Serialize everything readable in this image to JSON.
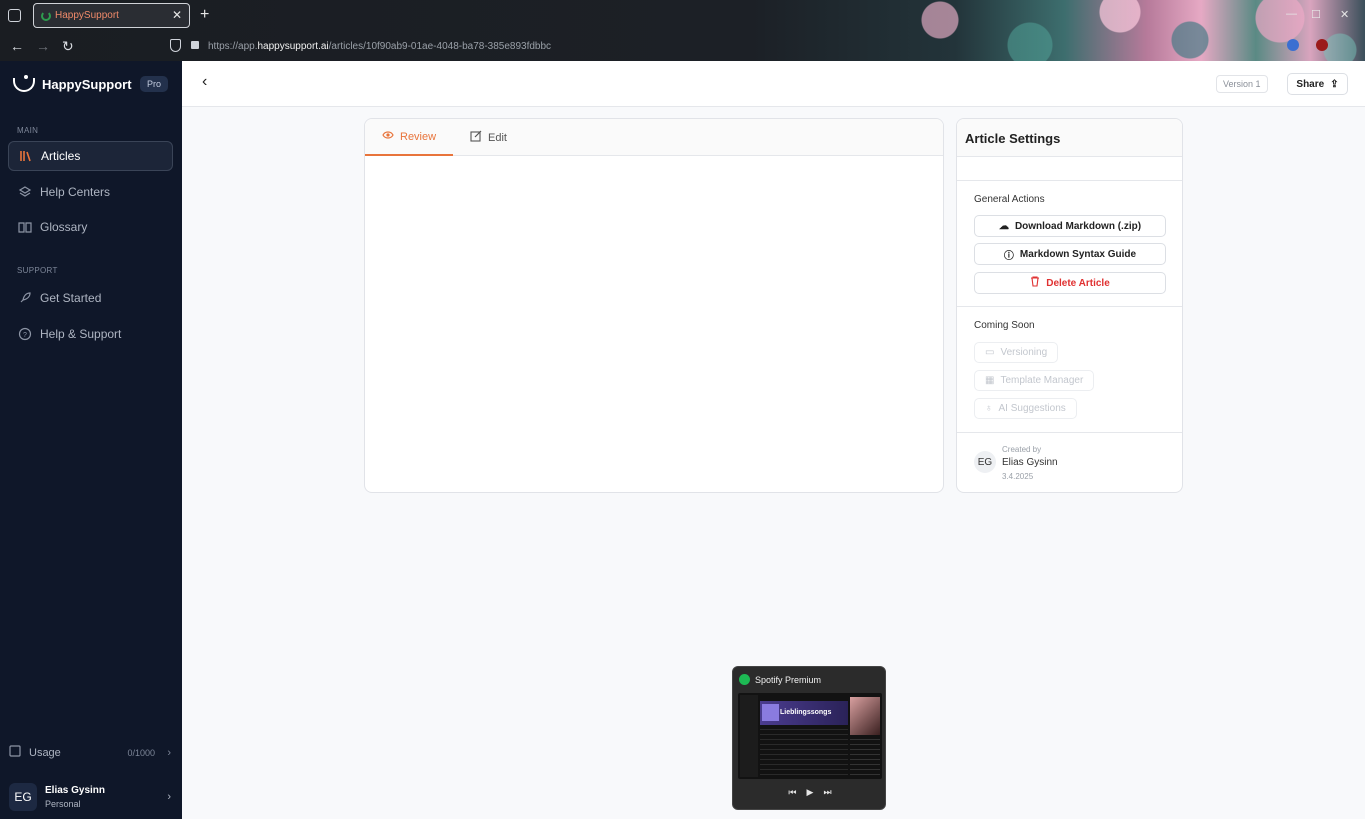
{
  "browser": {
    "tab_title": "HappySupport",
    "url_prefix": "https://app.",
    "url_domain": "happysupport.ai",
    "url_path": "/articles/10f90ab9-01ae-4048-ba78-385e893fdbbc"
  },
  "sidebar": {
    "brand": "HappySupport",
    "plan_badge": "Pro",
    "main_label": "MAIN",
    "main_items": [
      {
        "label": "Articles",
        "icon": "library-icon"
      },
      {
        "label": "Help Centers",
        "icon": "layers-icon"
      },
      {
        "label": "Glossary",
        "icon": "book-icon"
      }
    ],
    "support_label": "SUPPORT",
    "support_items": [
      {
        "label": "Get Started",
        "icon": "rocket-icon"
      },
      {
        "label": "Help & Support",
        "icon": "help-circle-icon"
      }
    ],
    "usage_label": "Usage",
    "usage_count": "0/1000",
    "user_initials": "EG",
    "user_name": "Elias Gysinn",
    "user_plan": "Personal"
  },
  "header": {
    "version": "Version 1",
    "share": "Share"
  },
  "editor": {
    "tab_review": "Review",
    "tab_edit": "Edit",
    "active_tab": "Review"
  },
  "settings": {
    "title": "Article Settings",
    "general_label": "General Actions",
    "download": "Download Markdown (.zip)",
    "syntax_guide": "Markdown Syntax Guide",
    "delete": "Delete Article",
    "coming_soon_label": "Coming Soon",
    "versioning": "Versioning",
    "template_manager": "Template Manager",
    "ai_suggestions": "AI Suggestions",
    "created_by_label": "Created by",
    "creator_initials": "EG",
    "creator_name": "Elias Gysinn",
    "created_date": "3.4.2025"
  },
  "spotify": {
    "title": "Spotify Premium",
    "playlist": "Lieblingssongs"
  },
  "colors": {
    "accent": "#e8743b",
    "danger": "#e03131",
    "sidebar_bg": "#0f1729"
  }
}
